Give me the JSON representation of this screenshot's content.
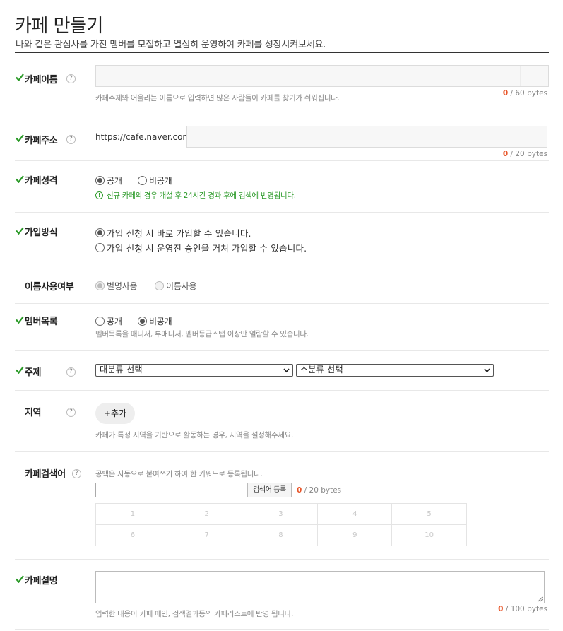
{
  "header": {
    "title": "카페 만들기",
    "subtitle": "나와 같은 관심사를 가진 멤버를 모집하고 열심히 운영하여 카페를 성장시켜보세요."
  },
  "cafe_name": {
    "label": "카페이름",
    "hint": "카페주제와 어울리는 이름으로 입력하면 많은 사람들이 카페를 찾기가 쉬워집니다.",
    "count": "0",
    "limit": "/ 60 bytes"
  },
  "cafe_address": {
    "label": "카페주소",
    "prefix": "https://cafe.naver.com/",
    "count": "0",
    "limit": "/ 20 bytes"
  },
  "cafe_type": {
    "label": "카페성격",
    "options": [
      "공개",
      "비공개"
    ],
    "selected": "공개",
    "note": "신규 카페의 경우 개설 후 24시간 경과 후에 검색에 반영됩니다."
  },
  "join_method": {
    "label": "가입방식",
    "options": [
      "가입 신청 시 바로 가입할 수 있습니다.",
      "가입 신청 시 운영진 승인을 거쳐 가입할 수 있습니다."
    ],
    "selected": "가입 신청 시 바로 가입할 수 있습니다."
  },
  "name_usage": {
    "label": "이름사용여부",
    "options": [
      "별명사용",
      "이름사용"
    ],
    "selected": "별명사용"
  },
  "member_list": {
    "label": "멤버목록",
    "options": [
      "공개",
      "비공개"
    ],
    "selected": "비공개",
    "hint": "멤버목록을 매니저, 부매니저, 멤버등급스탭 이상만 열람할 수 있습니다."
  },
  "topic": {
    "label": "주제",
    "major_placeholder": "대분류 선택",
    "minor_placeholder": "소분류 선택"
  },
  "region": {
    "label": "지역",
    "add_button": "+추가",
    "hint": "카페가 특정 지역을 기반으로 활동하는 경우, 지역을 설정해주세요."
  },
  "keywords": {
    "label": "카페검색어",
    "hint": "공백은 자동으로 붙여쓰기 하여 한 키워드로 등록됩니다.",
    "register_button": "검색어 등록",
    "count": "0",
    "limit": "/ 20 bytes",
    "slots": [
      "1",
      "2",
      "3",
      "4",
      "5",
      "6",
      "7",
      "8",
      "9",
      "10"
    ]
  },
  "description": {
    "label": "카페설명",
    "hint": "입력한 내용이 카페 메인, 검색결과등의 카페리스트에 반영 됩니다.",
    "count": "0",
    "limit": "/ 100 bytes"
  },
  "help_glyph": "?",
  "colors": {
    "check_green": "#2b9a28",
    "counter_orange": "#e8562a",
    "note_green": "#2b9a28"
  }
}
